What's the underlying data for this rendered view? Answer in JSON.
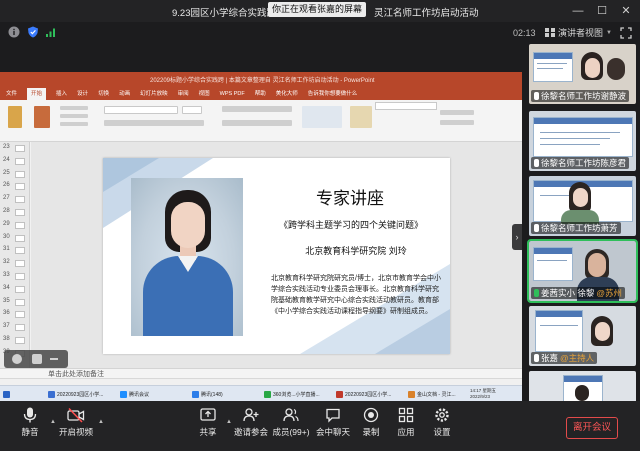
{
  "window": {
    "title_left": "9.23园区小学综合实践跨",
    "sharing_banner": "你正在观看张嘉的屏幕",
    "title_right": "灵江名师工作坊启动活动",
    "minimize": "—",
    "maximize": "☐",
    "close": "✕"
  },
  "status": {
    "timer": "02:13",
    "view_label": "演讲者视图"
  },
  "powerpoint": {
    "title": "202209标题小学综合实践跨 | 本篇文章整理自  灵江名师工作坊启动活动 - PowerPoint",
    "tabs": [
      "文件",
      "开始",
      "插入",
      "设计",
      "切换",
      "动画",
      "幻灯片放映",
      "审阅",
      "视图",
      "WPS PDF",
      "帮助",
      "美化大师",
      "告诉我你想要做什么"
    ],
    "search_placeholder": "告诉我你想做什么",
    "slide_numbers": [
      "23",
      "24",
      "25",
      "26",
      "27",
      "28",
      "29",
      "30",
      "31",
      "32",
      "33",
      "34",
      "35",
      "36",
      "37",
      "38",
      "39"
    ],
    "notes_placeholder": "单击此处添加备注",
    "slide": {
      "title": "专家讲座",
      "subtitle": "《跨学科主题学习的四个关键问题》",
      "org": "北京教育科学研究院   刘玲",
      "body": "北京教育科学研究院研究员/博士，北京市教育学会中小学综合实践活动专业委员会理事长。北京教育科学研究院基础教育教学研究中心综合实践活动教研员。教育部《中小学综合实践活动课程指导纲要》研制组成员。"
    },
    "taskbar": [
      {
        "label": "20220923园区小学...",
        "color": "#3b6fd1"
      },
      {
        "label": "腾讯会议",
        "color": "#1f8fff"
      },
      {
        "label": "腾讯(148)",
        "color": "#2b7de9"
      },
      {
        "label": "360浏览...小学直播...",
        "color": "#28a745"
      },
      {
        "label": "20220923园区小学...",
        "color": "#c0392b"
      },
      {
        "label": "金山文档 - 灵江...",
        "color": "#d9822b"
      }
    ],
    "tray_time": "14:17 星期五",
    "tray_date": "2022/9/23"
  },
  "participants": [
    {
      "name": "徐黎名师工作坊谢静波",
      "active": false
    },
    {
      "name": "徐黎名师工作坊陈彦君",
      "active": false
    },
    {
      "name": "徐黎名师工作坊萧芳",
      "active": false
    },
    {
      "name": "姜茜实小 徐黎",
      "extra": "@苏州",
      "active": true
    },
    {
      "name": "张嘉",
      "extra": "@主持人",
      "active": false
    },
    {
      "name": "",
      "active": false
    }
  ],
  "toolbar": {
    "mute": "静音",
    "video": "开启视频",
    "share": "共享",
    "invite": "邀请参会",
    "members": "成员(99+)",
    "chat": "会中聊天",
    "record": "录制",
    "apps": "应用",
    "settings": "设置",
    "end": "离开会议"
  },
  "colors": {
    "ppt_accent": "#b7472a",
    "active_speaker": "#2fbf5b",
    "end_button": "#e34b4b"
  }
}
